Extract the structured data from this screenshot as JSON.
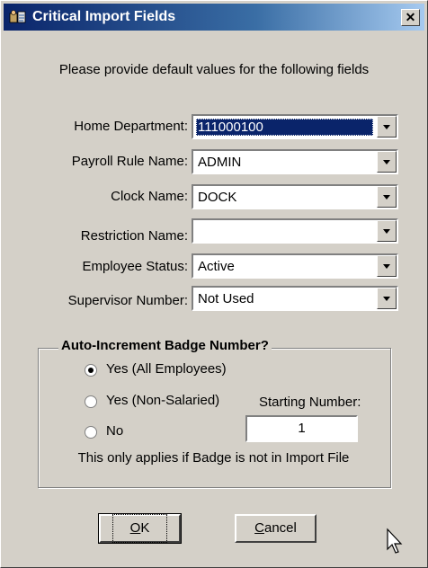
{
  "window": {
    "title": "Critical Import Fields",
    "close_glyph": "✕"
  },
  "instruction": "Please provide default values for the following fields",
  "fields": {
    "home_department": {
      "label": "Home Department:",
      "value": "111000100"
    },
    "payroll_rule": {
      "label": "Payroll Rule Name:",
      "value": "ADMIN"
    },
    "clock_name": {
      "label": "Clock Name:",
      "value": "DOCK"
    },
    "restriction_name": {
      "label": "Restriction Name:",
      "value": ""
    },
    "employee_status": {
      "label": "Employee Status:",
      "value": "Active"
    },
    "supervisor_number": {
      "label": "Supervisor Number:",
      "value": "Not Used"
    }
  },
  "badge_group": {
    "legend": "Auto-Increment Badge Number?",
    "options": [
      {
        "label": "Yes (All Employees)",
        "selected": true
      },
      {
        "label": "Yes (Non-Salaried)",
        "selected": false
      },
      {
        "label": "No",
        "selected": false
      }
    ],
    "starting_number_label": "Starting Number:",
    "starting_number_value": "1",
    "note": "This only applies if Badge is not in Import File"
  },
  "buttons": {
    "ok": {
      "mnemonic": "O",
      "rest": "K"
    },
    "cancel": {
      "mnemonic": "C",
      "rest": "ancel"
    }
  },
  "colors": {
    "titlebar_start": "#0a246a",
    "titlebar_end": "#a6caf0",
    "face": "#d4d0c8",
    "selection": "#0a246a"
  },
  "icons": {
    "app": "app-icon",
    "close": "close-icon",
    "dropdown": "chevron-down-icon",
    "cursor": "mouse-pointer-icon"
  }
}
